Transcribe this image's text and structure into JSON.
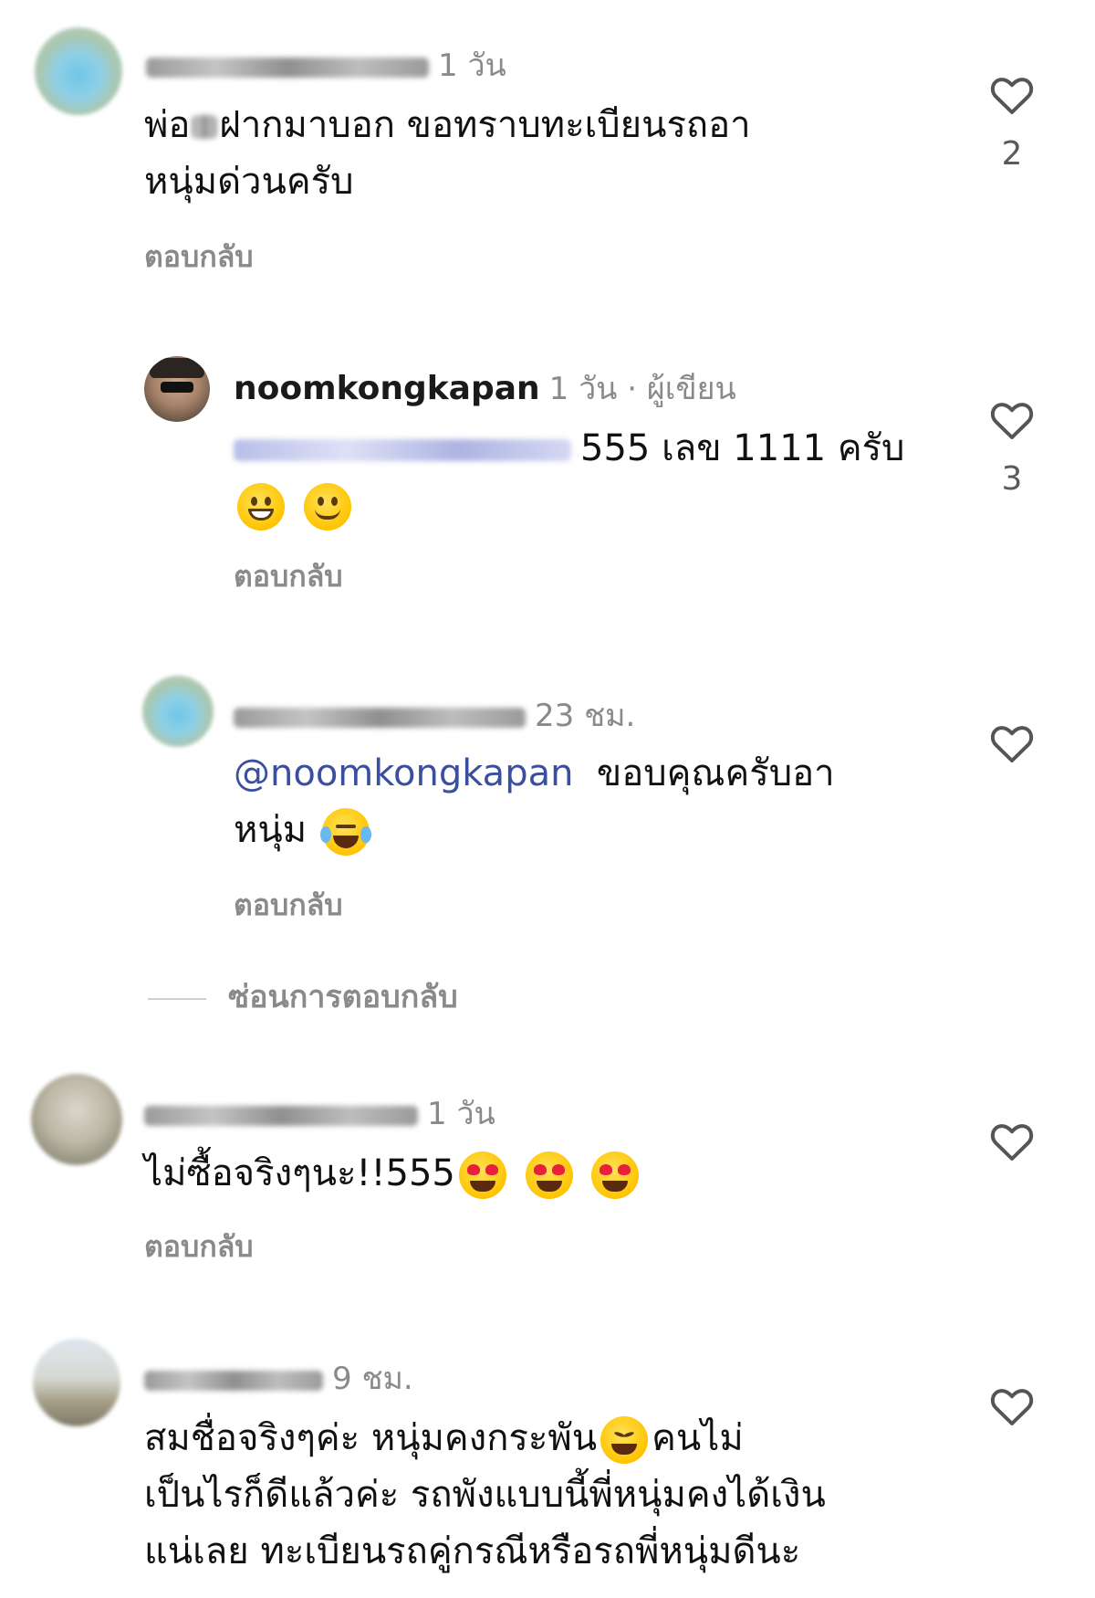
{
  "reply_label": "ตอบกลับ",
  "hide_replies_label": "ซ่อนการตอบกลับ",
  "comments": [
    {
      "username_blurred": true,
      "time": "1 วัน",
      "text": "พ่อ",
      "text_blurred_part": true,
      "text_rest": "ฝากมาบอก  ขอทราบทะเบียนรถอา",
      "text_line2": "หนุ่มด่วนครับ",
      "likes": "2"
    },
    {
      "username": "noomkongkapan",
      "time": "1 วัน",
      "author_label": "· ผู้เขียน",
      "mention_blurred": true,
      "text": "555 เลข 1111 ครับ",
      "emojis": [
        "grinning-face-emoji",
        "smiling-face-emoji"
      ],
      "likes": "3"
    },
    {
      "username_blurred": true,
      "time": "23 ชม.",
      "mention": "@noomkongkapan",
      "text": "ขอบคุณครับอา",
      "text_line2": "หนุ่ม",
      "emojis": [
        "tears-of-joy-emoji"
      ],
      "likes": ""
    },
    {
      "username_blurred": true,
      "time": "1 วัน",
      "text": "ไม่ซื้อจริงๆนะ!!555",
      "emojis": [
        "heart-eyes-emoji",
        "heart-eyes-emoji",
        "heart-eyes-emoji"
      ],
      "likes": ""
    },
    {
      "username_blurred": true,
      "time": "9 ชม.",
      "text": "สมชื่อจริงๆค่ะ หนุ่มคงกระพัน",
      "emoji_inline": "laughing-squint-emoji",
      "text_after_emoji": "คนไม่",
      "text_line2": "เป็นไรก็ดีแล้วค่ะ รถพังแบบนี้พี่หนุ่มคงได้เงิน",
      "text_line3": "แน่เลย ทะเบียนรถคู่กรณีหรือรถพี่หนุ่มดีนะ",
      "likes": ""
    }
  ]
}
